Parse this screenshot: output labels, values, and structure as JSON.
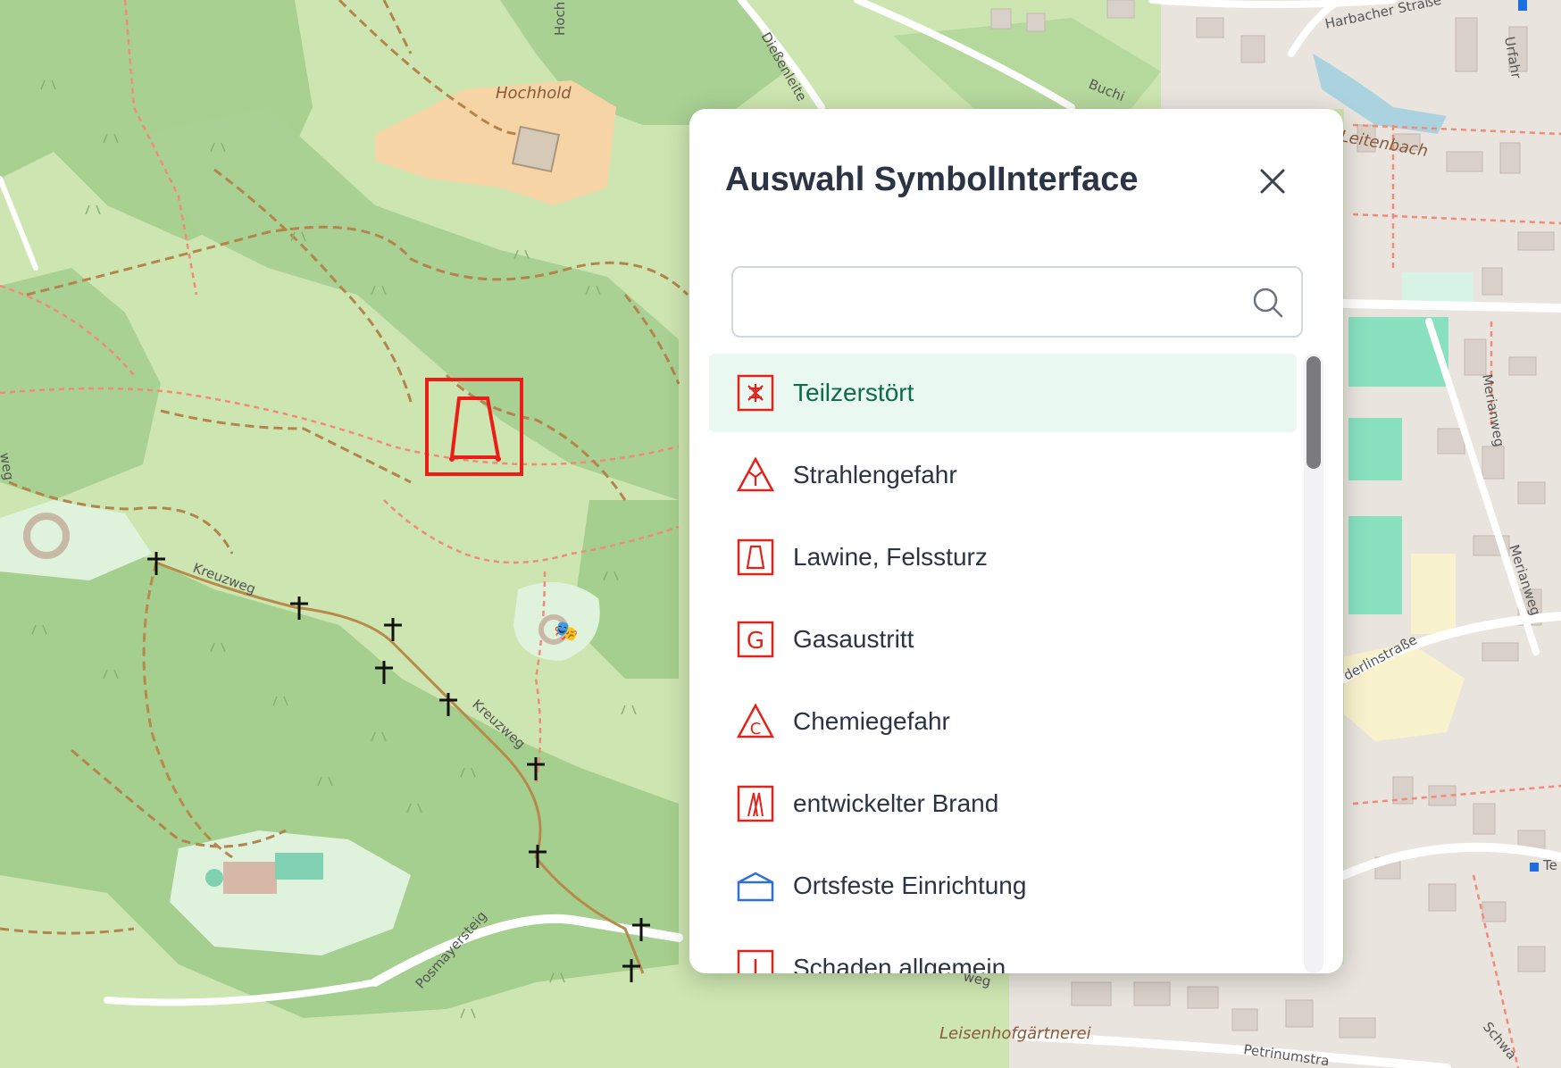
{
  "map": {
    "place_labels": {
      "hochhold": "Hochhold",
      "leisenhofgaertnerei": "Leisenhofgärtnerei",
      "leitenbach": "Leitenbach"
    },
    "street_labels": {
      "kreuzweg_1": "Kreuzweg",
      "kreuzweg_2": "Kreuzweg",
      "posmayersteig": "Posmayersteig",
      "diessenleiten": "Dießenleite",
      "buchi": "Buchi",
      "harbacher": "Harbacher Straße",
      "urfahr": "Urfahr",
      "merianweg_1": "Merianweg",
      "merianweg_2": "Merianweg",
      "derlinstrasse": "derlinstraße",
      "petrinumstr": "Petrinumstra",
      "schwa": "Schwa",
      "hoch": "Hoch",
      "weg_left": "weg",
      "weg_bottom": "weg",
      "te": "Te"
    },
    "placed_symbol": "lawine-felssturz-icon"
  },
  "dialog": {
    "title": "Auswahl SymbolInterface",
    "close_icon": "close-icon",
    "search": {
      "value": "",
      "placeholder": ""
    },
    "items": [
      {
        "label": "Teilzerstört",
        "icon": "teilzerstoert-icon",
        "color": "#e2231a",
        "selected": true
      },
      {
        "label": "Strahlengefahr",
        "icon": "strahlengefahr-icon",
        "color": "#e2231a",
        "selected": false
      },
      {
        "label": "Lawine, Felssturz",
        "icon": "lawine-felssturz-icon",
        "color": "#e2231a",
        "selected": false
      },
      {
        "label": "Gasaustritt",
        "icon": "gasaustritt-icon",
        "color": "#e2231a",
        "selected": false
      },
      {
        "label": "Chemiegefahr",
        "icon": "chemiegefahr-icon",
        "color": "#e2231a",
        "selected": false
      },
      {
        "label": "entwickelter Brand",
        "icon": "entwickelter-brand-icon",
        "color": "#e2231a",
        "selected": false
      },
      {
        "label": "Ortsfeste Einrichtung",
        "icon": "ortsfeste-einrichtung-icon",
        "color": "#2f6fd6",
        "selected": false
      },
      {
        "label": "Schaden allgemein",
        "icon": "schaden-allgemein-icon",
        "color": "#e2231a",
        "selected": false
      }
    ],
    "selected_color": "#e9f8f1",
    "accent_color": "#0d6b4a"
  }
}
